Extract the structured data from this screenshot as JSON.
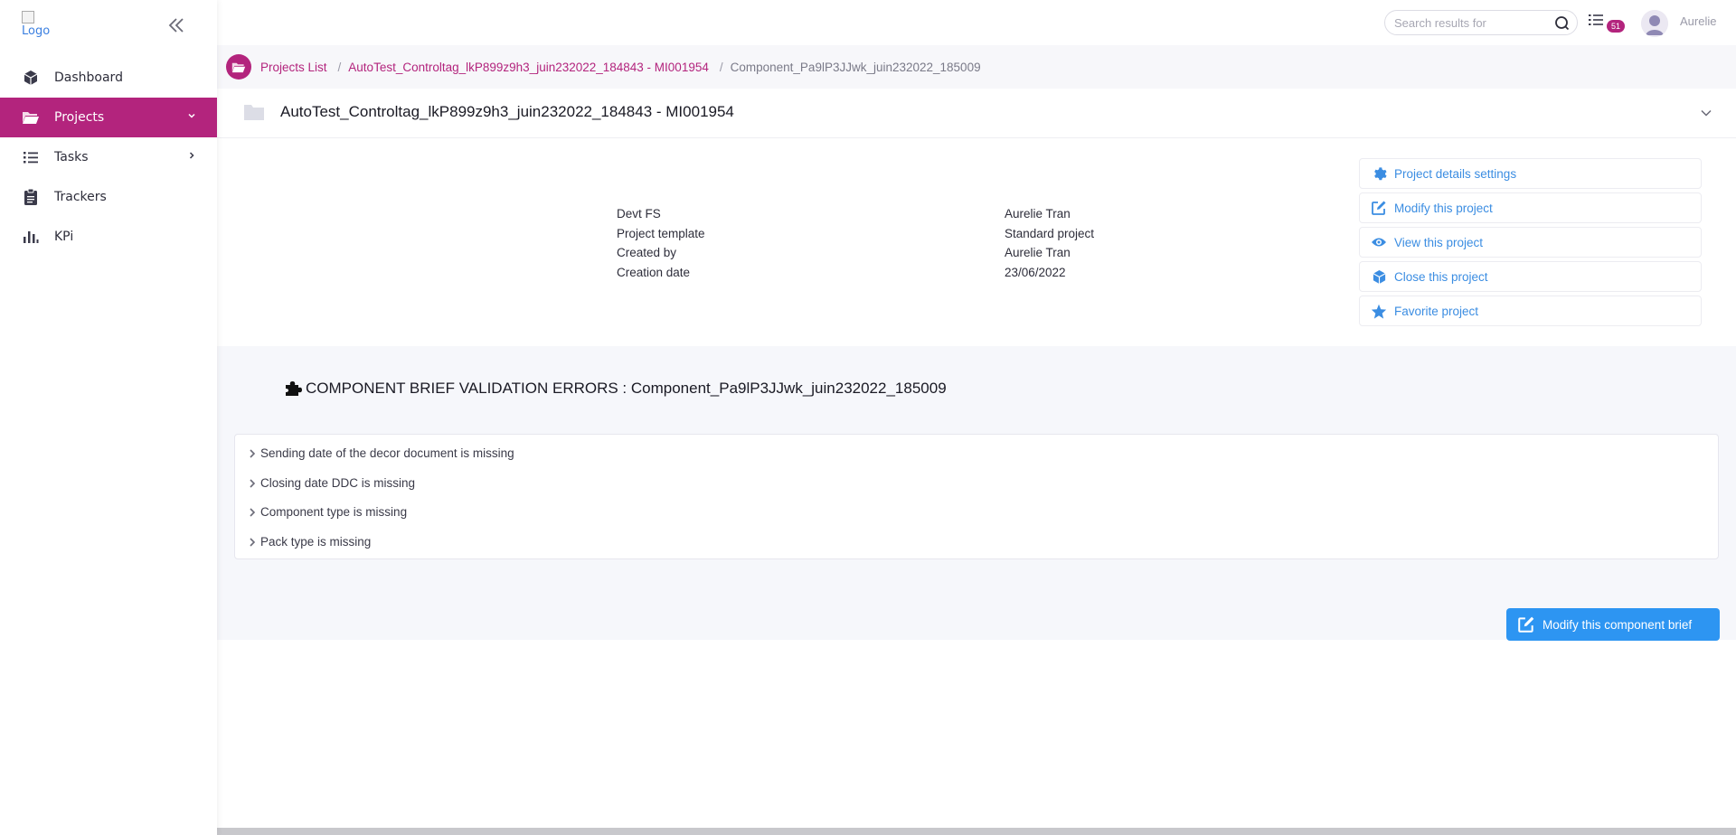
{
  "sidebar": {
    "logo_alt": "Logo",
    "items": [
      {
        "label": "Dashboard",
        "icon": "cube-icon"
      },
      {
        "label": "Projects",
        "icon": "folder-open-icon",
        "active": true
      },
      {
        "label": "Tasks",
        "icon": "list-icon"
      },
      {
        "label": "Trackers",
        "icon": "clipboard-icon"
      },
      {
        "label": "KPi",
        "icon": "bar-chart-icon"
      }
    ]
  },
  "topbar": {
    "search_placeholder": "Search results for",
    "tasks_count": "51",
    "username": "Aurelie"
  },
  "breadcrumb": {
    "items": [
      {
        "label": "Projects List"
      },
      {
        "label": "AutoTest_Controltag_lkP899z9h3_juin232022_184843 - MI001954"
      },
      {
        "label": "Component_Pa9lP3JJwk_juin232022_185009"
      }
    ],
    "separator": "/"
  },
  "project": {
    "title": "AutoTest_Controltag_lkP899z9h3_juin232022_184843 - MI001954",
    "details": [
      {
        "label": "Devt FS",
        "value": "Aurelie Tran"
      },
      {
        "label": "Project template",
        "value": "Standard project"
      },
      {
        "label": "Created by",
        "value": "Aurelie Tran"
      },
      {
        "label": "Creation date",
        "value": "23/06/2022"
      }
    ],
    "actions": [
      {
        "label": "Project details settings",
        "icon": "gear-icon"
      },
      {
        "label": "Modify this project",
        "icon": "edit-icon"
      },
      {
        "label": "View this project",
        "icon": "eye-icon"
      },
      {
        "label": "Close this project",
        "icon": "box-icon"
      },
      {
        "label": "Favorite project",
        "icon": "star-icon"
      }
    ]
  },
  "validation": {
    "title": "COMPONENT BRIEF VALIDATION ERRORS : Component_Pa9lP3JJwk_juin232022_185009",
    "errors": [
      "Sending date of the decor document is missing",
      "Closing date DDC is missing",
      "Component type is missing",
      "Pack type is missing"
    ],
    "button_label": "Modify this component brief"
  },
  "colors": {
    "accent": "#b3247d",
    "link_blue": "#3b8de2",
    "button_blue": "#2d95f2"
  }
}
